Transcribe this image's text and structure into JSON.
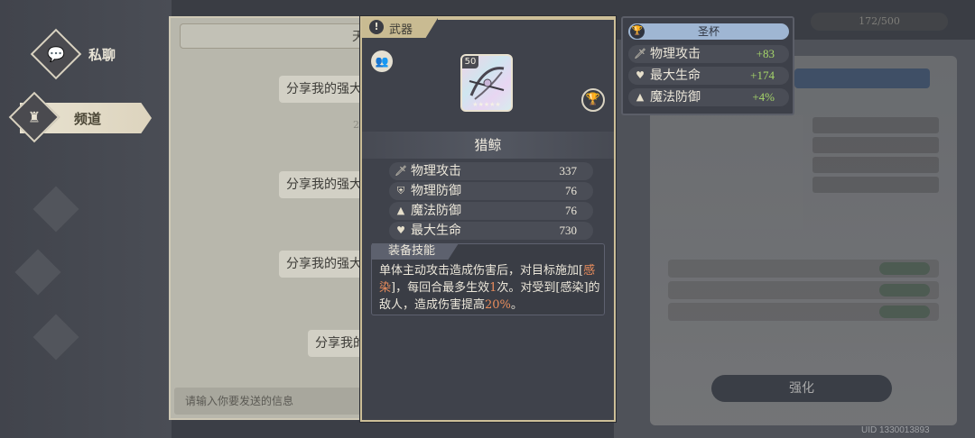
{
  "nav": {
    "items": [
      {
        "label": "私聊",
        "icon": "chat-bubble-icon"
      },
      {
        "label": "频道",
        "icon": "chess-rook-icon"
      }
    ]
  },
  "chat": {
    "title": "天",
    "messages": [
      "分享我的强大",
      "分享我的强大",
      "分享我的强大",
      "分享我的"
    ],
    "time_fragment": "2",
    "input_placeholder": "请输入你要发送的信息"
  },
  "weapon": {
    "category": "武器",
    "level": "50",
    "stars": "★★★★★",
    "name": "猎鲸",
    "stats": [
      {
        "icon": "sword-icon",
        "label": "物理攻击",
        "value": "337"
      },
      {
        "icon": "shield-icon",
        "label": "物理防御",
        "value": "76"
      },
      {
        "icon": "wizard-hat-icon",
        "label": "魔法防御",
        "value": "76"
      },
      {
        "icon": "heart-icon",
        "label": "最大生命",
        "value": "730"
      }
    ],
    "skill_title": "装备技能",
    "skill": {
      "part1": "单体主动攻击造成伤害后，对目标施加[",
      "hl1": "感染",
      "part2": "]，每回合最多生效",
      "hl2": "1",
      "part3": "次。对受到[感染]的敌人，造成伤害提高",
      "hl3": "20%",
      "part4": "。"
    }
  },
  "grail": {
    "title": "圣杯",
    "bonuses": [
      {
        "icon": "sword-icon",
        "label": "物理攻击",
        "value": "+83"
      },
      {
        "icon": "heart-icon",
        "label": "最大生命",
        "value": "+174"
      },
      {
        "icon": "wizard-hat-icon",
        "label": "魔法防御",
        "value": "+4%"
      }
    ]
  },
  "background": {
    "counter": "172/500",
    "enhance_button": "强化",
    "uid": "UID 1330013893"
  },
  "colors": {
    "highlight": "#e88c5c",
    "bonus_green": "#a6d66a",
    "panel_gold": "#cdbf98",
    "grail_blue": "#9fb6d3"
  }
}
